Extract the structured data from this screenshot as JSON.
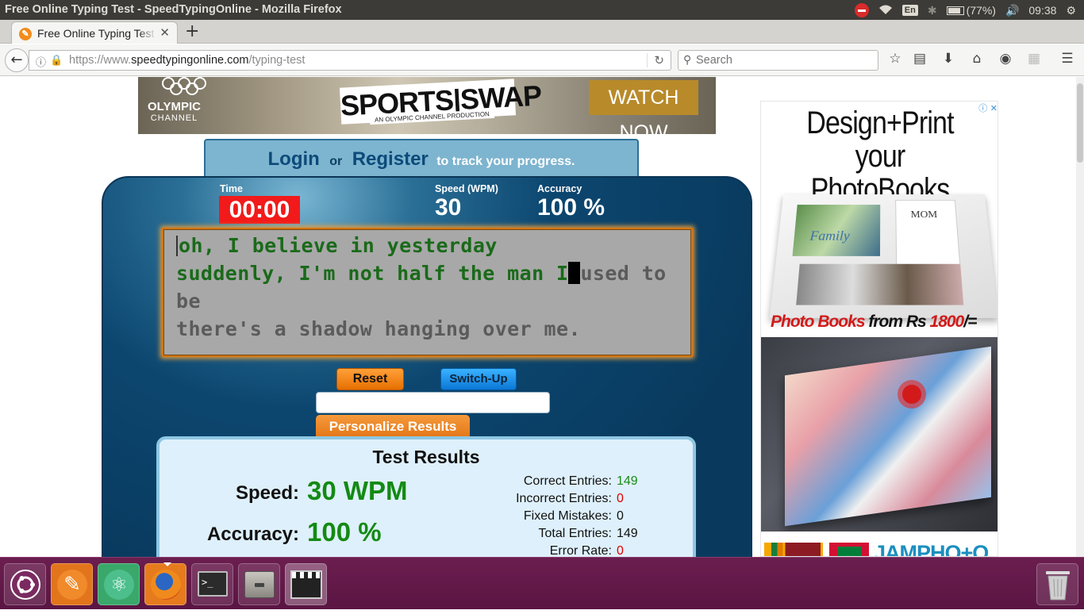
{
  "os_bar": {
    "window_title": "Free Online Typing Test - SpeedTypingOnline - Mozilla Firefox",
    "keyboard_layout": "En",
    "battery": "(77%)",
    "time": "09:38"
  },
  "browser": {
    "tab_title": "Free Online Typing Test - SpeedTypingOnline",
    "url_prefix": "https://www.",
    "url_domain": "speedtypingonline.com",
    "url_path": "/typing-test",
    "search_placeholder": "Search"
  },
  "banner_ad": {
    "brand": "OLYMPIC",
    "brand_sub": "CHANNEL",
    "headline": "SPORTS|SWAP",
    "subline": "AN OLYMPIC CHANNEL PRODUCTION",
    "cta": "WATCH NOW"
  },
  "login_bar": {
    "login": "Login",
    "or": "or",
    "register": "Register",
    "tail": "to track your progress."
  },
  "stats": {
    "time_label": "Time",
    "time_value": "00:00",
    "speed_label": "Speed (WPM)",
    "speed_value": "30",
    "accuracy_label": "Accuracy",
    "accuracy_value": "100 %"
  },
  "typing_text": {
    "line1_done": "oh, I believe in yesterday",
    "line2_done": "suddenly, I'm not half the man I",
    "line2_rest": "used to",
    "line3": "be",
    "line4": "there's a shadow hanging over me."
  },
  "buttons": {
    "reset": "Reset",
    "switch_up": "Switch-Up",
    "personalize": "Personalize Results"
  },
  "results": {
    "title": "Test Results",
    "speed_label": "Speed:",
    "speed_value": "30 WPM",
    "accuracy_label": "Accuracy:",
    "accuracy_value": "100 %",
    "entries": [
      {
        "label": "Correct Entries:",
        "value": "149",
        "color": "green"
      },
      {
        "label": "Incorrect Entries:",
        "value": "0",
        "color": "red"
      },
      {
        "label": "Fixed Mistakes:",
        "value": "0",
        "color": "black"
      },
      {
        "label": "Total Entries:",
        "value": "149",
        "color": "black"
      },
      {
        "label": "Error Rate:",
        "value": "0",
        "color": "red"
      }
    ]
  },
  "side_ad": {
    "headline_1": "Design+Print your",
    "headline_2": "PhotoBooks easily",
    "book_family": "Family",
    "book_mom": "MOM",
    "offer_red": "Photo Books",
    "offer_black": " from Rs ",
    "offer_price": "1800",
    "offer_tail": "/=",
    "brand": "JAMPHO+O"
  },
  "colors": {
    "panel_dark": "#0c466f",
    "timer_bg": "#f21a1a",
    "correct_text": "#1a6a1a",
    "accent_orange": "#e66f00",
    "accent_blue": "#0a77d6",
    "launcher_bg": "#5a1543"
  },
  "launcher": {
    "items": [
      "ubuntu-dash-icon",
      "scratchpad-icon",
      "atom-icon",
      "firefox-icon",
      "terminal-icon",
      "files-icon",
      "video-editor-icon",
      "trash-icon"
    ]
  }
}
